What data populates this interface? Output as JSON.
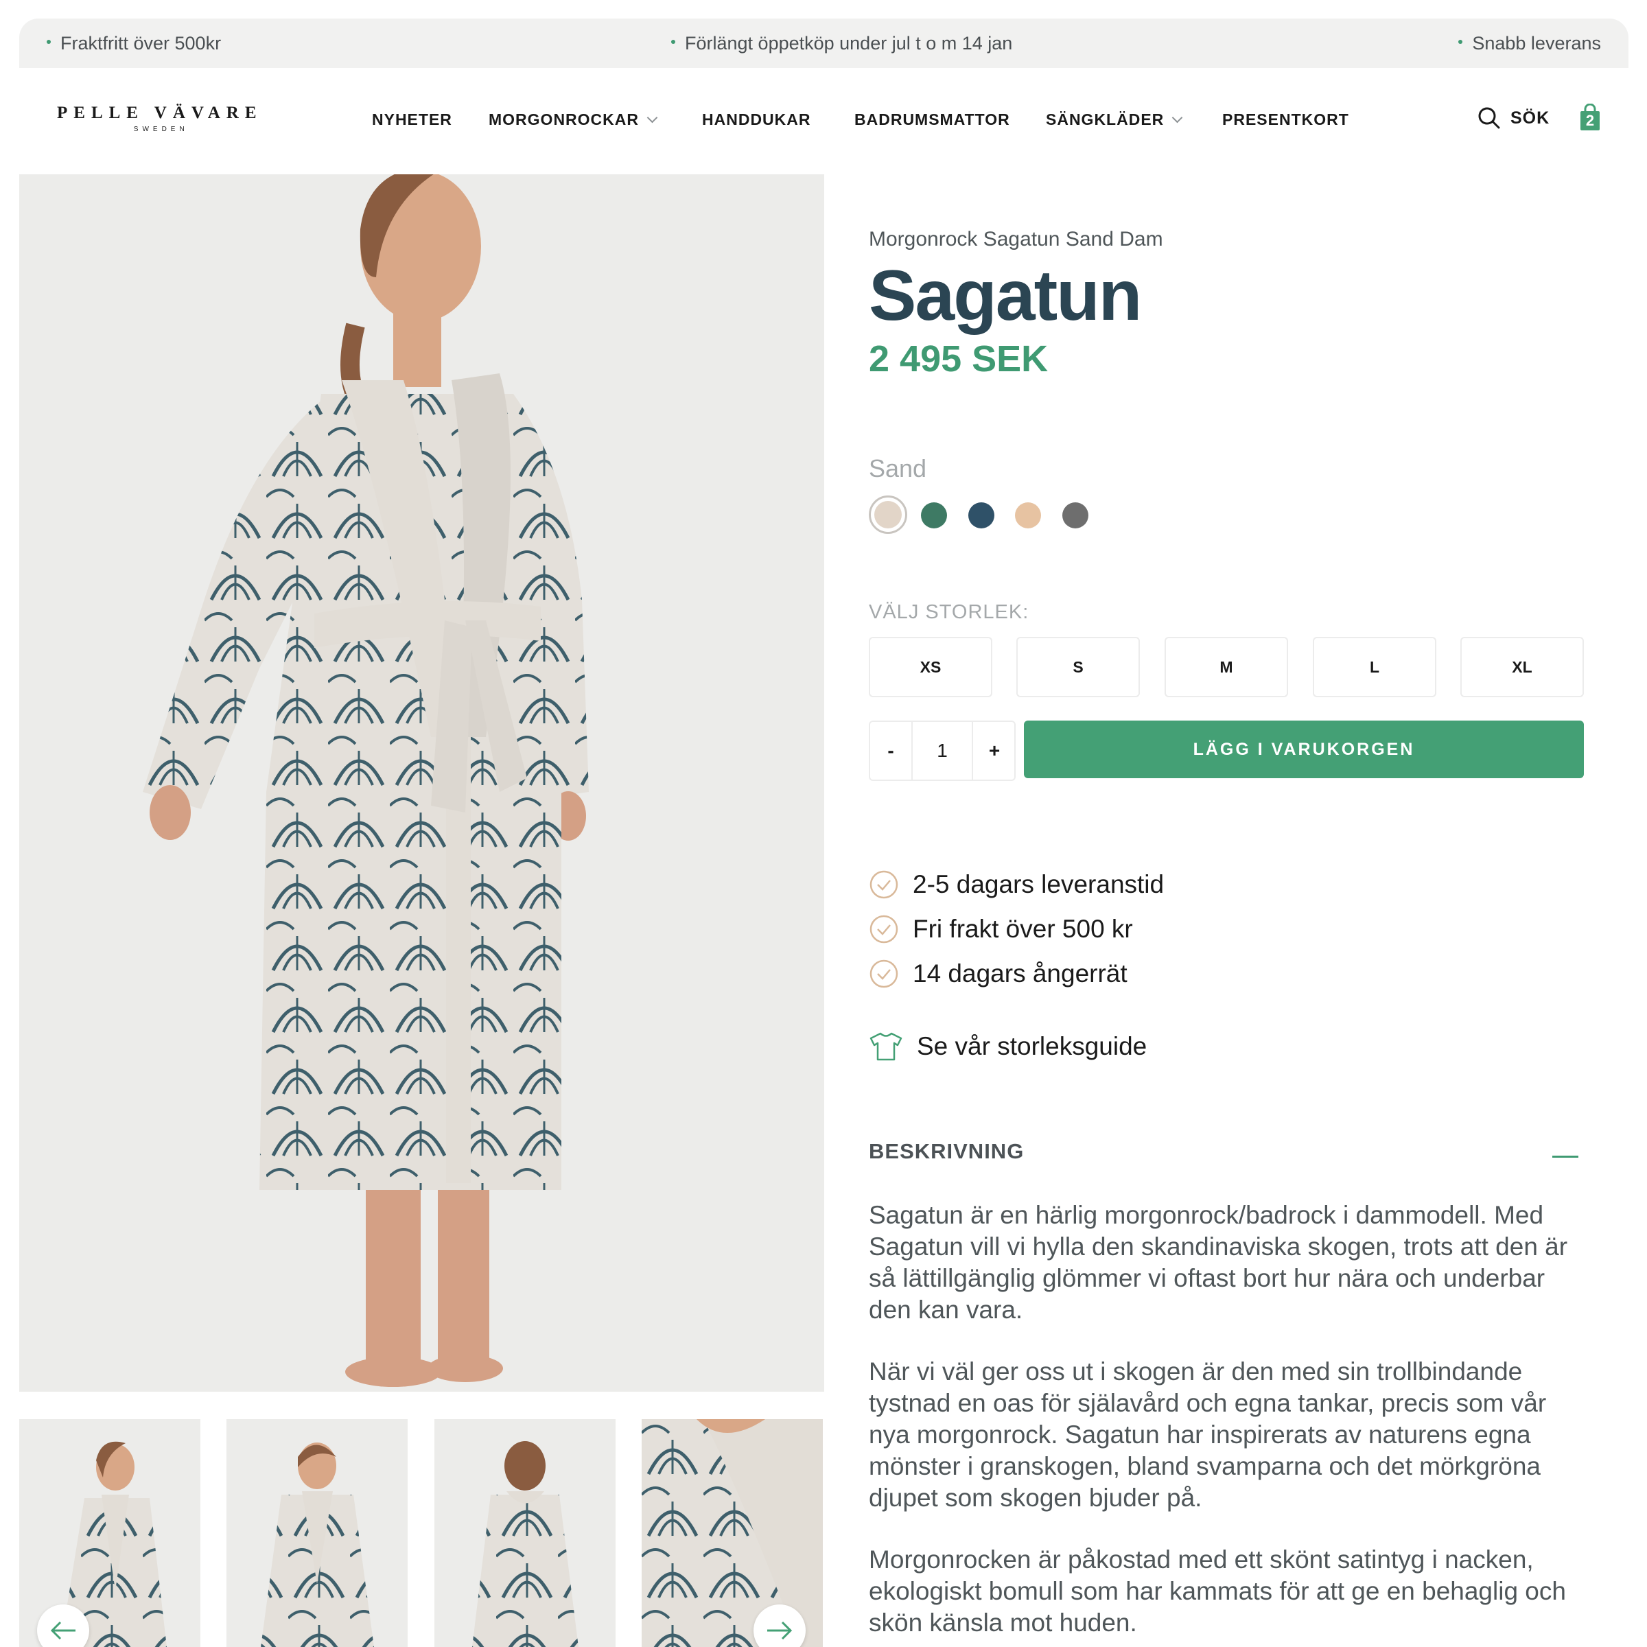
{
  "announcements": {
    "left": "Fraktfritt över 500kr",
    "center": "Förlängt öppetköp under jul t o m 14 jan",
    "right": "Snabb leverans"
  },
  "header": {
    "logo_brand": "PELLE VÄVARE",
    "logo_sub": "SWEDEN",
    "nav": [
      {
        "label": "NYHETER",
        "has_dropdown": false
      },
      {
        "label": "MORGONROCKAR",
        "has_dropdown": true
      },
      {
        "label": "HANDDUKAR",
        "has_dropdown": false
      },
      {
        "label": "BADRUMSMATTOR",
        "has_dropdown": false
      },
      {
        "label": "SÄNGKLÄDER",
        "has_dropdown": true
      },
      {
        "label": "PRESENTKORT",
        "has_dropdown": false
      }
    ],
    "search_label": "SÖK",
    "cart_count": "2"
  },
  "product": {
    "subtitle": "Morgonrock Sagatun Sand Dam",
    "title": "Sagatun",
    "price": "2 495 SEK",
    "selected_color": "Sand",
    "colors": [
      {
        "name": "sand",
        "hex": "#e2d5c8",
        "selected": true
      },
      {
        "name": "green",
        "hex": "#3e7a64",
        "selected": false
      },
      {
        "name": "blue",
        "hex": "#2f5168",
        "selected": false
      },
      {
        "name": "peach",
        "hex": "#e7c3a2",
        "selected": false
      },
      {
        "name": "grey",
        "hex": "#6e6e6e",
        "selected": false
      }
    ],
    "size_label": "VÄLJ STORLEK:",
    "sizes": [
      "XS",
      "S",
      "M",
      "L",
      "XL"
    ],
    "quantity": {
      "minus": "-",
      "value": "1",
      "plus": "+"
    },
    "add_to_cart": "LÄGG I VARUKORGEN",
    "usps": [
      "2-5 dagars leveranstid",
      "Fri frakt över 500 kr",
      "14 dagars ångerrät"
    ],
    "size_guide": "Se vår storleksguide",
    "description_heading": "BESKRIVNING",
    "description": [
      "Sagatun är en härlig morgonrock/badrock i dammodell. Med Sagatun vill vi hylla den skandinaviska skogen, trots att den är så lättillgänglig glömmer vi oftast bort hur nära och underbar den kan vara.",
      "När vi väl ger oss ut i skogen är den med sin trollbindande tystnad en oas för själavård och egna tankar, precis som vår nya morgonrock. Sagatun har inspirerats av naturens egna mönster i granskogen, bland svamparna och det mörkgröna djupet som skogen bjuder på.",
      "Morgonrocken är påkostad med ett skönt satintyg i nacken, ekologiskt bomull som har kammats för att ge en behaglig och skön känsla mot huden."
    ]
  },
  "colors": {
    "accent_green": "#44a075",
    "title_blue": "#2b4553",
    "robe_pattern": "#3e5f6b",
    "robe_base": "#e4e0da"
  }
}
